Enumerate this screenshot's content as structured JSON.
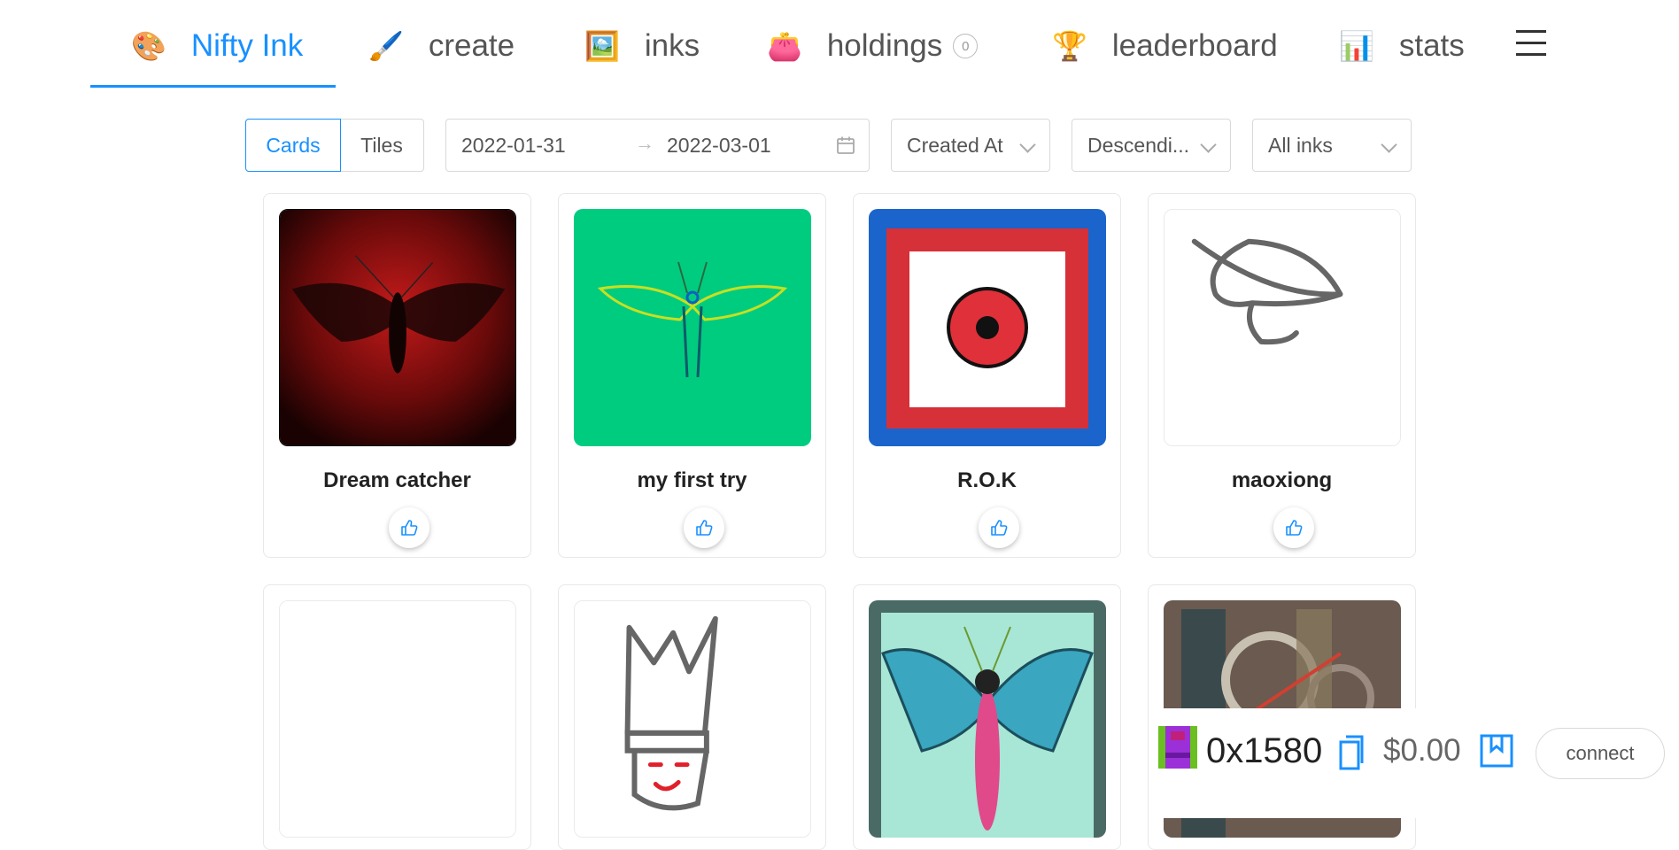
{
  "nav": {
    "items": [
      {
        "emoji": "🎨",
        "label": "Nifty Ink",
        "icon": "palette-icon"
      },
      {
        "emoji": "🖌️",
        "label": "create",
        "icon": "brush-icon"
      },
      {
        "emoji": "🖼️",
        "label": "inks",
        "icon": "framed-picture-icon"
      },
      {
        "emoji": "👛",
        "label": "holdings",
        "icon": "purse-icon"
      },
      {
        "emoji": "🏆",
        "label": "leaderboard",
        "icon": "trophy-icon"
      },
      {
        "emoji": "📊",
        "label": "stats",
        "icon": "bar-chart-icon"
      }
    ],
    "holdings_count": "0",
    "active": "Nifty Ink"
  },
  "toolbar": {
    "view_options": [
      "Cards",
      "Tiles"
    ],
    "view_selected": "Cards",
    "date_start": "2022-01-31",
    "date_end": "2022-03-01",
    "range_arrow": "→",
    "sort_field": "Created At",
    "sort_order": "Descendi...",
    "filter": "All inks"
  },
  "cards": [
    {
      "title": "Dream catcher"
    },
    {
      "title": "my first try"
    },
    {
      "title": "R.O.K"
    },
    {
      "title": "maoxiong"
    },
    {
      "title": ""
    },
    {
      "title": ""
    },
    {
      "title": ""
    },
    {
      "title": ""
    }
  ],
  "wallet": {
    "address": "0x1580",
    "balance": "$0.00",
    "connect_label": "connect"
  },
  "colors": {
    "accent": "#1890ff",
    "border": "#d9d9d9"
  }
}
